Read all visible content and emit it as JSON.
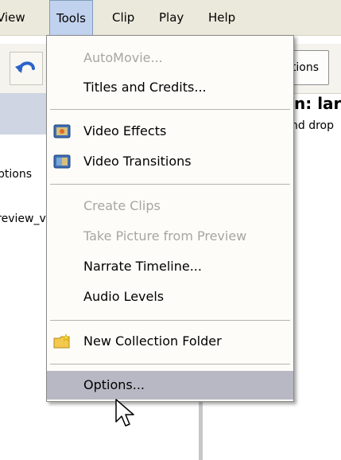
{
  "menubar": {
    "items": [
      {
        "label": "View"
      },
      {
        "label": "Tools"
      },
      {
        "label": "Clip"
      },
      {
        "label": "Play"
      },
      {
        "label": "Help"
      }
    ]
  },
  "toolbar": {
    "options_button_label": "Options"
  },
  "left_pane": {
    "item1": "Options",
    "item2": "Preview_v"
  },
  "main": {
    "heading": "n: lar",
    "subtext": "nd drop"
  },
  "tools_menu": {
    "items": [
      {
        "label": "AutoMovie...",
        "enabled": false,
        "icon": null
      },
      {
        "label": "Titles and Credits...",
        "enabled": true,
        "icon": null
      },
      {
        "label": "Video Effects",
        "enabled": true,
        "icon": "video-effects-icon"
      },
      {
        "label": "Video Transitions",
        "enabled": true,
        "icon": "video-transitions-icon"
      },
      {
        "label": "Create Clips",
        "enabled": false,
        "icon": null
      },
      {
        "label": "Take Picture from Preview",
        "enabled": false,
        "icon": null
      },
      {
        "label": "Narrate Timeline...",
        "enabled": true,
        "icon": null
      },
      {
        "label": "Audio Levels",
        "enabled": true,
        "icon": null
      },
      {
        "label": "New Collection Folder",
        "enabled": true,
        "icon": "new-folder-icon"
      },
      {
        "label": "Options...",
        "enabled": true,
        "highlighted": true,
        "icon": null
      }
    ]
  },
  "colors": {
    "menu_highlight": "#b8b8c4",
    "disabled_text": "#a7a6a0",
    "active_menu": "#c1d2ee"
  }
}
